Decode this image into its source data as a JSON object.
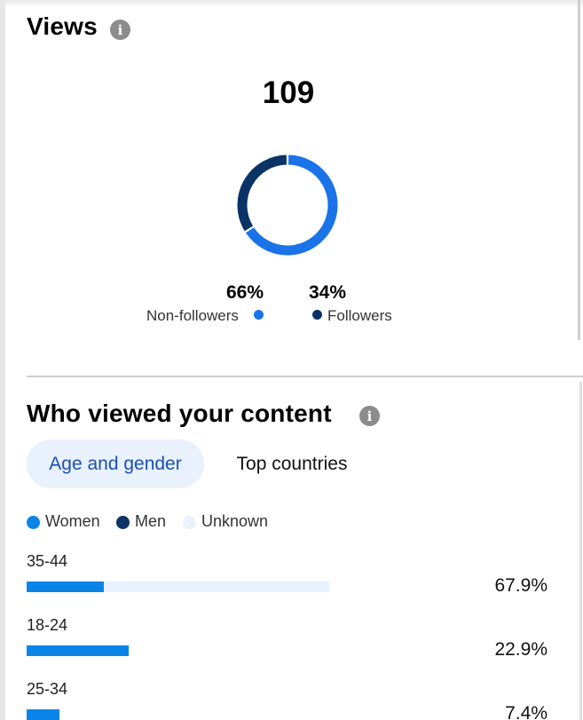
{
  "views": {
    "title": "Views",
    "info_icon": "info-icon",
    "count": "109",
    "non_followers": {
      "percent_label": "66%",
      "label": "Non-followers",
      "fraction": 0.66,
      "color": "#1a73e8"
    },
    "followers": {
      "percent_label": "34%",
      "label": "Followers",
      "fraction": 0.34,
      "color": "#0a3366"
    }
  },
  "audience": {
    "title": "Who viewed your content",
    "info_icon": "info-icon",
    "tabs": [
      {
        "label": "Age and gender",
        "active": true
      },
      {
        "label": "Top countries",
        "active": false
      }
    ],
    "legend": [
      {
        "label": "Women",
        "color": "#0a84e8"
      },
      {
        "label": "Men",
        "color": "#0a3366"
      },
      {
        "label": "Unknown",
        "color": "#e8f1fc"
      }
    ],
    "rows": [
      {
        "age": "35-44",
        "value_label": "67.9%",
        "women_fraction": 0.255,
        "unknown_fraction": 0.745,
        "total_fraction": 0.679
      },
      {
        "age": "18-24",
        "value_label": "22.9%",
        "women_fraction": 1.0,
        "unknown_fraction": 0.0,
        "total_fraction": 0.229
      },
      {
        "age": "25-34",
        "value_label": "7.4%",
        "women_fraction": 1.0,
        "unknown_fraction": 0.0,
        "total_fraction": 0.074
      }
    ]
  }
}
